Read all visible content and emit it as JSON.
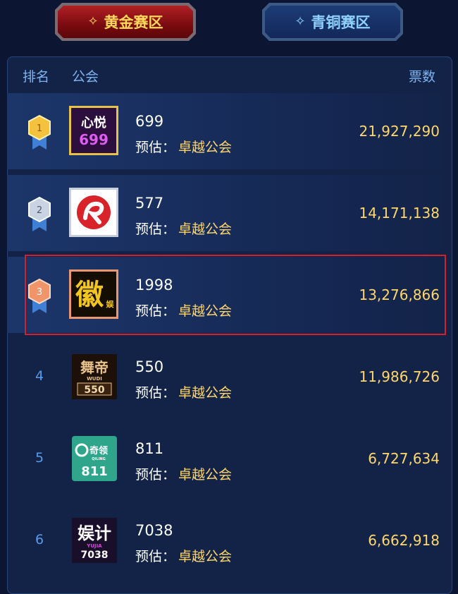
{
  "tabs": {
    "gold": "黄金赛区",
    "bronze": "青铜赛区"
  },
  "header": {
    "rank": "排名",
    "guild": "公会",
    "votes": "票数"
  },
  "rows": [
    {
      "rank": "1",
      "name": "699",
      "sub_label": "预估：",
      "sub_value": "卓越公会",
      "votes": "21,927,290",
      "logo_text": "心悦\n699"
    },
    {
      "rank": "2",
      "name": "577",
      "sub_label": "预估：",
      "sub_value": "卓越公会",
      "votes": "14,171,138",
      "logo_text": ""
    },
    {
      "rank": "3",
      "name": "1998",
      "sub_label": "预估：",
      "sub_value": "卓越公会",
      "votes": "13,276,866",
      "logo_text": "徽 娱"
    },
    {
      "rank": "4",
      "name": "550",
      "sub_label": "预估：",
      "sub_value": "卓越公会",
      "votes": "11,986,726",
      "logo_text": "舞帝\nWUDI\n550"
    },
    {
      "rank": "5",
      "name": "811",
      "sub_label": "预估：",
      "sub_value": "卓越公会",
      "votes": "6,727,634",
      "logo_text": "奇领\nQILING\n811"
    },
    {
      "rank": "6",
      "name": "7038",
      "sub_label": "预估：",
      "sub_value": "卓越公会",
      "votes": "6,662,918",
      "logo_text": "娱计\nYUJIA\n7038"
    }
  ],
  "colors": {
    "accent_gold": "#ffd76a",
    "rank_blue": "#5a9ae8",
    "highlight_border": "#d4202c"
  }
}
